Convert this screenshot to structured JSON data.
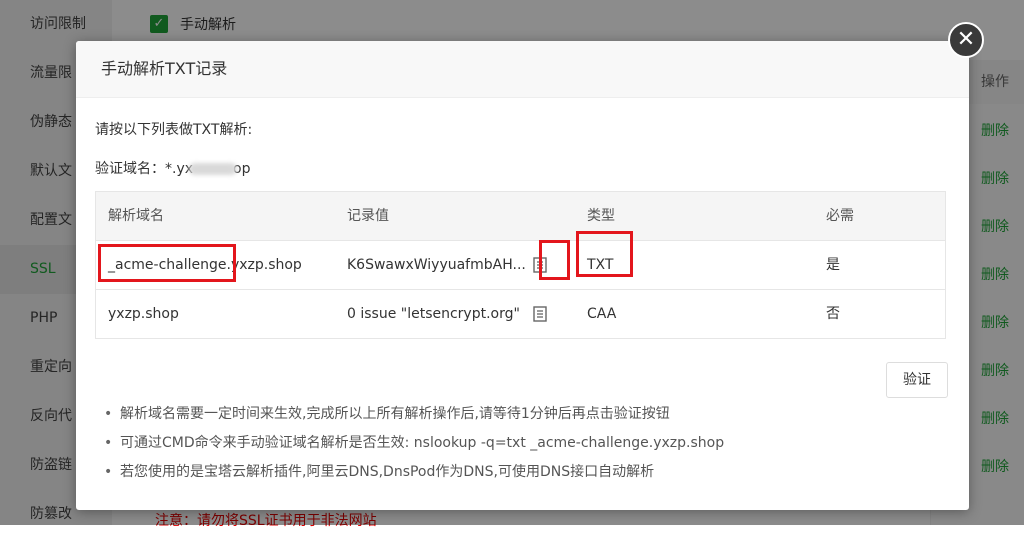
{
  "background": {
    "sidebar_items": [
      "访问限制",
      "流量限",
      "伪静态",
      "默认文",
      "配置文",
      "SSL",
      "PHP",
      "重定向",
      "反向代",
      "防盗链",
      "防篡改"
    ],
    "checkbox_label": "手动解析",
    "ops_header": "操作",
    "delete_label": "删除",
    "bottom_note": "注意：请勿将SSL证书用于非法网站"
  },
  "dialog": {
    "title": "手动解析TXT记录",
    "intro": "请按以下列表做TXT解析:",
    "domain_label": "验证域名：",
    "domain_prefix": "*.yx",
    "domain_suffix": "op",
    "columns": [
      "解析域名",
      "记录值",
      "类型",
      "必需"
    ],
    "rows": [
      {
        "domain": "_acme-challenge.yxzp.shop",
        "value": "K6SwawxWiyyuafmbAH...",
        "type": "TXT",
        "required": "是"
      },
      {
        "domain": "yxzp.shop",
        "value": "0 issue \"letsencrypt.org\"",
        "type": "CAA",
        "required": "否"
      }
    ],
    "verify_button": "验证",
    "notes": [
      "解析域名需要一定时间来生效,完成所以上所有解析操作后,请等待1分钟后再点击验证按钮",
      "可通过CMD命令来手动验证域名解析是否生效: nslookup -q=txt _acme-challenge.yxzp.shop",
      "若您使用的是宝塔云解析插件,阿里云DNS,DnsPod作为DNS,可使用DNS接口自动解析"
    ]
  },
  "colors": {
    "accent": "#20a53a",
    "highlight": "#e3161c",
    "overlay": "rgba(0,0,0,0.45)"
  },
  "icons": [
    "checkbox-checked-icon",
    "close-icon",
    "copy-icon"
  ]
}
